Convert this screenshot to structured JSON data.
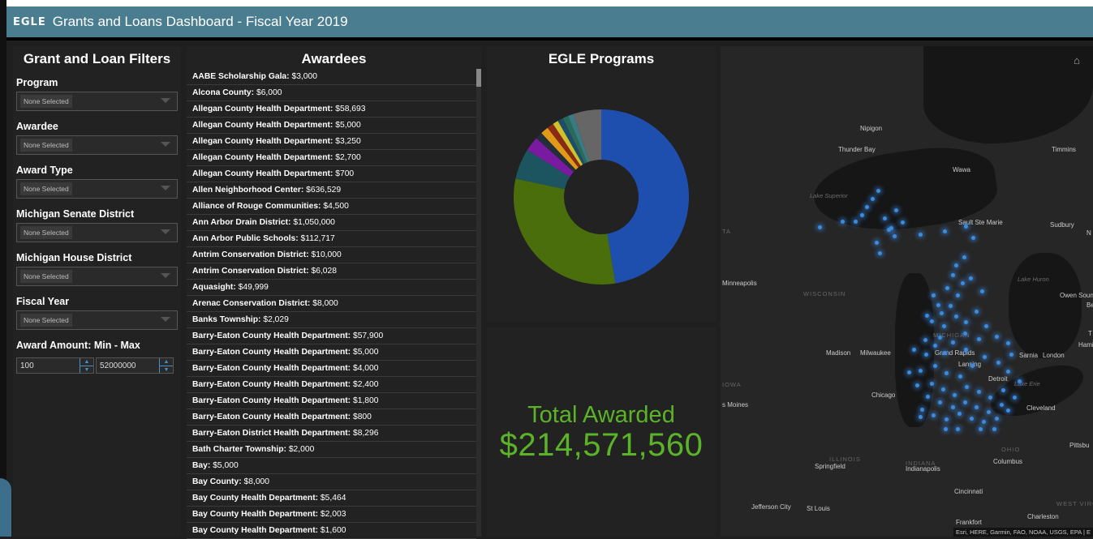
{
  "header": {
    "logo": "EGLE",
    "title": "Grants and Loans Dashboard - Fiscal Year 2019"
  },
  "filters": {
    "title": "Grant and Loan Filters",
    "fields": [
      {
        "label": "Program",
        "value": "None Selected"
      },
      {
        "label": "Awardee",
        "value": "None Selected"
      },
      {
        "label": "Award Type",
        "value": "None Selected"
      },
      {
        "label": "Michigan Senate District",
        "value": "None Selected"
      },
      {
        "label": "Michigan House District",
        "value": "None Selected"
      },
      {
        "label": "Fiscal Year",
        "value": "None Selected"
      }
    ],
    "amount_label": "Award Amount: Min - Max",
    "min": "100",
    "max": "52000000"
  },
  "awardees": {
    "title": "Awardees",
    "rows": [
      {
        "name": "AABE Scholarship Gala:",
        "amount": "$3,000"
      },
      {
        "name": "Alcona County:",
        "amount": "$6,000"
      },
      {
        "name": "Allegan County Health Department:",
        "amount": "$58,693"
      },
      {
        "name": "Allegan County Health Department:",
        "amount": "$5,000"
      },
      {
        "name": "Allegan County Health Department:",
        "amount": "$3,250"
      },
      {
        "name": "Allegan County Health Department:",
        "amount": "$2,700"
      },
      {
        "name": "Allegan County Health Department:",
        "amount": "$700"
      },
      {
        "name": "Allen Neighborhood Center:",
        "amount": "$636,529"
      },
      {
        "name": "Alliance of Rouge Communities:",
        "amount": "$4,500"
      },
      {
        "name": "Ann Arbor Drain District:",
        "amount": "$1,050,000"
      },
      {
        "name": "Ann Arbor Public Schools:",
        "amount": "$112,717"
      },
      {
        "name": "Antrim Conservation District:",
        "amount": "$10,000"
      },
      {
        "name": "Antrim Conservation District:",
        "amount": "$6,028"
      },
      {
        "name": "Aquasight:",
        "amount": "$49,999"
      },
      {
        "name": "Arenac Conservation District:",
        "amount": "$8,000"
      },
      {
        "name": "Banks Township:",
        "amount": "$2,029"
      },
      {
        "name": "Barry-Eaton County Health Department:",
        "amount": "$57,900"
      },
      {
        "name": "Barry-Eaton County Health Department:",
        "amount": "$5,000"
      },
      {
        "name": "Barry-Eaton County Health Department:",
        "amount": "$4,000"
      },
      {
        "name": "Barry-Eaton County Health Department:",
        "amount": "$2,400"
      },
      {
        "name": "Barry-Eaton County Health Department:",
        "amount": "$1,800"
      },
      {
        "name": "Barry-Eaton County Health Department:",
        "amount": "$800"
      },
      {
        "name": "Barry-Eaton District Health Department:",
        "amount": "$8,296"
      },
      {
        "name": "Bath Charter Township:",
        "amount": "$2,000"
      },
      {
        "name": "Bay:",
        "amount": "$5,000"
      },
      {
        "name": "Bay County:",
        "amount": "$8,000"
      },
      {
        "name": "Bay County Health Department:",
        "amount": "$5,464"
      },
      {
        "name": "Bay County Health Department:",
        "amount": "$2,003"
      },
      {
        "name": "Bay County Health Department:",
        "amount": "$1,600"
      }
    ]
  },
  "programs": {
    "title": "EGLE Programs",
    "slices": [
      {
        "value": 46,
        "color": "#1f4fae"
      },
      {
        "value": 30,
        "color": "#4a6e0c"
      },
      {
        "value": 5.5,
        "color": "#1c5560"
      },
      {
        "value": 2.6,
        "color": "#7a1aa0"
      },
      {
        "value": 1.3,
        "color": "#222f3a"
      },
      {
        "value": 1.4,
        "color": "#e09a18"
      },
      {
        "value": 1.2,
        "color": "#8a2a14"
      },
      {
        "value": 1.0,
        "color": "#cfc12a"
      },
      {
        "value": 1.0,
        "color": "#1e4d6b"
      },
      {
        "value": 1.0,
        "color": "#2a6a5a"
      },
      {
        "value": 1.0,
        "color": "#3a7a82"
      },
      {
        "value": 5.0,
        "color": "#666666"
      }
    ]
  },
  "total": {
    "label": "Total Awarded",
    "value": "$214,571,560",
    "color": "#5bb328"
  },
  "map": {
    "labels": {
      "nipigon": "Nipigon",
      "thunder_bay": "Thunder Bay",
      "timmins": "Timmins",
      "wawa": "Wawa",
      "lake_superior": "Lake Superior",
      "sault": "Sault Ste Marie",
      "sudbury": "Sudbury",
      "minneapolis": "Minneapolis",
      "wisconsin": "WISCONSIN",
      "lake_huron": "Lake Huron",
      "owen_sound": "Owen Sound",
      "michigan": "MICHIGAN",
      "madison": "Madison",
      "milwaukee": "Milwaukee",
      "grand_rapids": "Grand Rapids",
      "lansing": "Lansing",
      "sarnia": "Sarnia",
      "london": "London",
      "detroit": "Detroit",
      "iowa": "IOWA",
      "chicago": "Chicago",
      "lake_erie": "Lake Erie",
      "des_moines": "s Moines",
      "cleveland": "Cleveland",
      "illinois": "ILLINOIS",
      "indiana": "INDIANA",
      "ohio": "OHIO",
      "pittsburgh": "Pittsbu",
      "springfield": "Springfield",
      "indianapolis": "Indianapolis",
      "columbus": "Columbus",
      "cincinnati": "Cincinnati",
      "jefferson_city": "Jefferson City",
      "st_louis": "St Louis",
      "west_virginia": "WEST VIRGINIA",
      "frankfort": "Frankfort",
      "charleston": "Charleston",
      "ta": "TA",
      "hamilton": "Hamil",
      "toronto": "T",
      "be": "Be",
      "n": "N"
    },
    "attribution": "Esri, HERE, Garmin, FAO, NOAA, USGS, EPA | E",
    "home_icon": "home-icon"
  }
}
